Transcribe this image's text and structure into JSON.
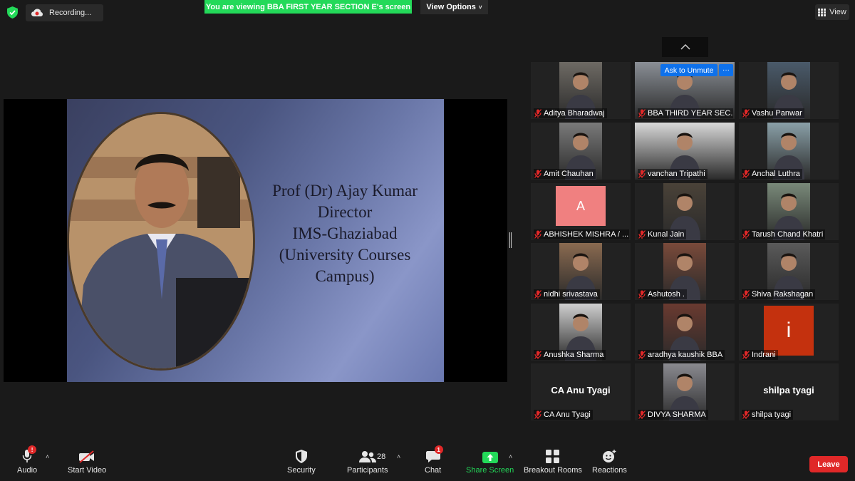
{
  "top": {
    "recording": "Recording...",
    "banner": "You are viewing BBA FIRST YEAR SECTION E's screen",
    "view_options": "View Options",
    "view": "View"
  },
  "slide": {
    "lines": [
      "Prof (Dr) Ajay Kumar",
      "Director",
      "IMS-Ghaziabad",
      "(University Courses",
      "Campus)"
    ]
  },
  "tiles": [
    {
      "name": "Aditya Bharadwaj",
      "kind": "video"
    },
    {
      "name": "BBA THIRD YEAR SEC...",
      "kind": "video",
      "ask_label": "Ask to Unmute",
      "more_label": "···"
    },
    {
      "name": "Vashu Panwar",
      "kind": "video"
    },
    {
      "name": "Amit Chauhan",
      "kind": "video"
    },
    {
      "name": "vanchan Tripathi",
      "kind": "video"
    },
    {
      "name": "Anchal Luthra",
      "kind": "video"
    },
    {
      "name": "ABHISHEK MISHRA / ...",
      "kind": "letter",
      "letter": "A",
      "color": "#f08080"
    },
    {
      "name": "Kunal Jain",
      "kind": "video"
    },
    {
      "name": "Tarush Chand Khatri",
      "kind": "video"
    },
    {
      "name": "nidhi srivastava",
      "kind": "video"
    },
    {
      "name": "Ashutosh .",
      "kind": "video"
    },
    {
      "name": "Shiva Rakshagan",
      "kind": "video"
    },
    {
      "name": "Anushka Sharma",
      "kind": "video"
    },
    {
      "name": "aradhya kaushik BBA",
      "kind": "video"
    },
    {
      "name": "Indrani",
      "kind": "letter",
      "letter": "i",
      "color": "#c4310e"
    },
    {
      "name": "CA Anu Tyagi",
      "kind": "text",
      "big": "CA Anu Tyagi"
    },
    {
      "name": "DIVYA SHARMA",
      "kind": "video"
    },
    {
      "name": "shilpa tyagi",
      "kind": "text",
      "big": "shilpa tyagi"
    }
  ],
  "toolbar": {
    "audio": "Audio",
    "audio_badge": "!",
    "start_video": "Start Video",
    "security": "Security",
    "participants": "Participants",
    "participants_count": "28",
    "chat": "Chat",
    "chat_badge": "1",
    "share_screen": "Share Screen",
    "breakout_rooms": "Breakout Rooms",
    "reactions": "Reactions",
    "leave": "Leave"
  },
  "colors": {
    "accent_green": "#23d959",
    "leave_red": "#e02828",
    "unmute_blue": "#0e71eb"
  }
}
